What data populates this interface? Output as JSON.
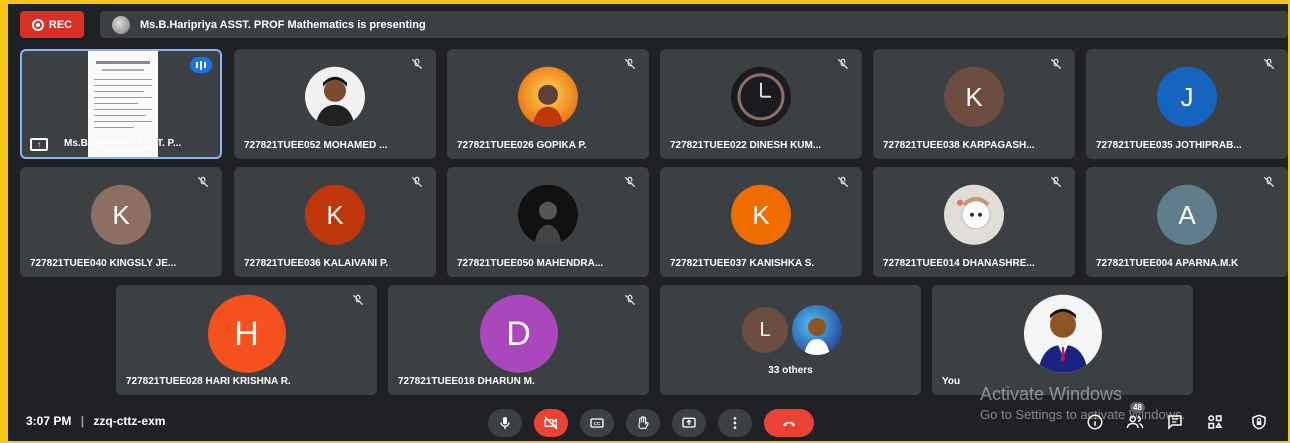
{
  "recording": {
    "label": "REC"
  },
  "presenting_banner": {
    "text": "Ms.B.Haripriya ASST. PROF Mathematics is presenting"
  },
  "tiles": [
    {
      "name": "Ms.B.Haripriya ASST. P...",
      "type": "presentation"
    },
    {
      "name": "727821TUEE052 MOHAMED ...",
      "type": "photo",
      "photo": "man-white-bg"
    },
    {
      "name": "727821TUEE026 GOPIKA P.",
      "type": "photo",
      "photo": "deity-orange"
    },
    {
      "name": "727821TUEE022 DINESH KUM...",
      "type": "photo",
      "photo": "clock-dark"
    },
    {
      "name": "727821TUEE038 KARPAGASH...",
      "type": "letter",
      "letter": "K",
      "color": "#6d4c41"
    },
    {
      "name": "727821TUEE035 JOTHIPRAB...",
      "type": "letter",
      "letter": "J",
      "color": "#1565c0"
    },
    {
      "name": "727821TUEE040 KINGSLY JE...",
      "type": "letter",
      "letter": "K",
      "color": "#8d6e63"
    },
    {
      "name": "727821TUEE036 KALAIVANI P.",
      "type": "letter",
      "letter": "K",
      "color": "#bf360c"
    },
    {
      "name": "727821TUEE050 MAHENDRA...",
      "type": "photo",
      "photo": "dark-figure"
    },
    {
      "name": "727821TUEE037 KANISHKA S.",
      "type": "letter",
      "letter": "K",
      "color": "#ef6c00"
    },
    {
      "name": "727821TUEE014 DHANASHRE...",
      "type": "photo",
      "photo": "cartoon"
    },
    {
      "name": "727821TUEE004 APARNA.M.K",
      "type": "letter",
      "letter": "A",
      "color": "#607d8b"
    },
    {
      "name": "727821TUEE028 HARI KRISHNA R.",
      "type": "letter",
      "letter": "H",
      "color": "#f4511e"
    },
    {
      "name": "727821TUEE018 DHARUN M.",
      "type": "letter",
      "letter": "D",
      "color": "#ab47bc"
    },
    {
      "name": "33 others",
      "type": "others",
      "letter": "L",
      "color": "#6d4c41"
    },
    {
      "name": "You",
      "type": "photo",
      "photo": "man-suit"
    }
  ],
  "bottom": {
    "time": "3:07 PM",
    "separator": "|",
    "meeting_code": "zzq-cttz-exm",
    "people_count": "48"
  },
  "watermark": {
    "title": "Activate Windows",
    "subtitle": "Go to Settings to activate Windows."
  },
  "colors": {
    "background": "#202124",
    "tile": "#3c4043",
    "accent": "#8ab4f8",
    "end_call": "#ea4335",
    "border": "#f7c515"
  }
}
